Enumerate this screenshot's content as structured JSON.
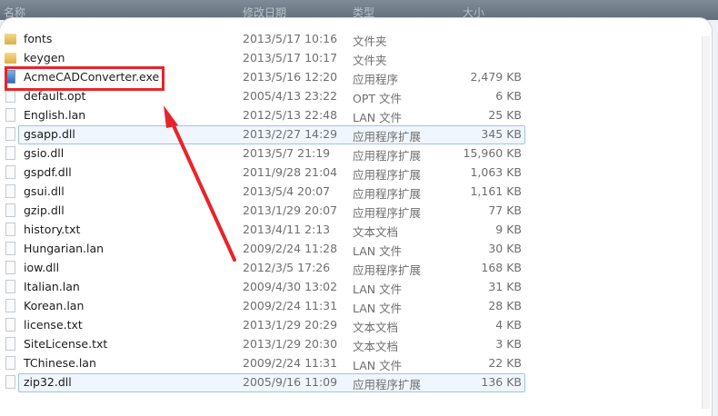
{
  "columns": {
    "name": "名称",
    "modified": "修改日期",
    "type": "类型",
    "size": "大小"
  },
  "colors": {
    "highlight": "#e8242a",
    "selection_border": "#9fc3e8"
  },
  "files": [
    {
      "name": "fonts",
      "modified": "2013/5/17 10:16",
      "type": "文件夹",
      "size": "",
      "icon": "folder-icon"
    },
    {
      "name": "keygen",
      "modified": "2013/5/17 10:17",
      "type": "文件夹",
      "size": "",
      "icon": "folder-icon"
    },
    {
      "name": "AcmeCADConverter.exe",
      "modified": "2013/5/16 12:20",
      "type": "应用程序",
      "size": "2,479 KB",
      "icon": "application-icon"
    },
    {
      "name": "default.opt",
      "modified": "2005/4/13 23:22",
      "type": "OPT 文件",
      "size": "6 KB",
      "icon": "file-icon"
    },
    {
      "name": "English.lan",
      "modified": "2012/5/13 22:48",
      "type": "LAN 文件",
      "size": "25 KB",
      "icon": "file-icon"
    },
    {
      "name": "gsapp.dll",
      "modified": "2013/2/27 14:29",
      "type": "应用程序扩展",
      "size": "345 KB",
      "icon": "file-icon"
    },
    {
      "name": "gsio.dll",
      "modified": "2013/5/7 21:19",
      "type": "应用程序扩展",
      "size": "15,960 KB",
      "icon": "file-icon"
    },
    {
      "name": "gspdf.dll",
      "modified": "2011/9/28 21:04",
      "type": "应用程序扩展",
      "size": "1,063 KB",
      "icon": "file-icon"
    },
    {
      "name": "gsui.dll",
      "modified": "2013/5/4 20:07",
      "type": "应用程序扩展",
      "size": "1,161 KB",
      "icon": "file-icon"
    },
    {
      "name": "gzip.dll",
      "modified": "2013/1/29 20:07",
      "type": "应用程序扩展",
      "size": "77 KB",
      "icon": "file-icon"
    },
    {
      "name": "history.txt",
      "modified": "2013/4/11 2:13",
      "type": "文本文档",
      "size": "9 KB",
      "icon": "file-icon"
    },
    {
      "name": "Hungarian.lan",
      "modified": "2009/2/24 11:28",
      "type": "LAN 文件",
      "size": "30 KB",
      "icon": "file-icon"
    },
    {
      "name": "iow.dll",
      "modified": "2012/3/5 17:26",
      "type": "应用程序扩展",
      "size": "168 KB",
      "icon": "file-icon"
    },
    {
      "name": "Italian.lan",
      "modified": "2009/4/30 13:02",
      "type": "LAN 文件",
      "size": "31 KB",
      "icon": "file-icon"
    },
    {
      "name": "Korean.lan",
      "modified": "2009/2/24 11:31",
      "type": "LAN 文件",
      "size": "28 KB",
      "icon": "file-icon"
    },
    {
      "name": "license.txt",
      "modified": "2013/1/29 20:29",
      "type": "文本文档",
      "size": "4 KB",
      "icon": "file-icon"
    },
    {
      "name": "SiteLicense.txt",
      "modified": "2013/1/29 20:30",
      "type": "文本文档",
      "size": "3 KB",
      "icon": "file-icon"
    },
    {
      "name": "TChinese.lan",
      "modified": "2009/2/24 11:31",
      "type": "LAN 文件",
      "size": "22 KB",
      "icon": "file-icon"
    },
    {
      "name": "zip32.dll",
      "modified": "2005/9/16 11:09",
      "type": "应用程序扩展",
      "size": "136 KB",
      "icon": "file-icon"
    }
  ]
}
